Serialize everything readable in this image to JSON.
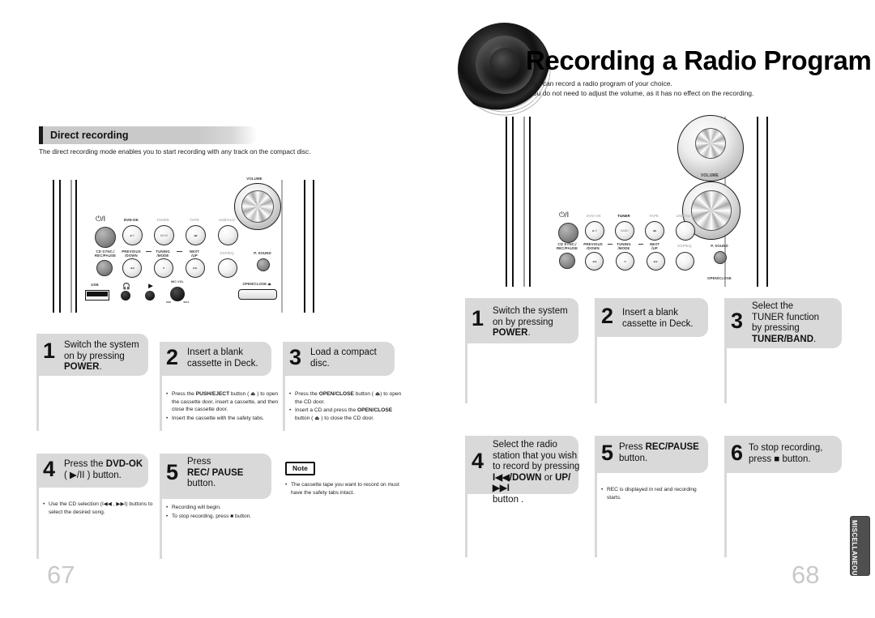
{
  "document": {
    "type": "user-manual-spread",
    "left_page_number": "67",
    "right_page_number": "68",
    "side_tab_label": "MISCELLANEOUS"
  },
  "left_page": {
    "section": {
      "title": "Direct recording",
      "description": "The direct recording mode enables you to start recording with any track on the compact disc."
    },
    "device_panel": {
      "power_glyph": "⏻/I",
      "labels": {
        "volume": "VOLUME",
        "dvd_ok": "DVD-OK",
        "tuner": "TUNER",
        "tape": "TAPE",
        "usb_aux": "USB/AUX",
        "cd_sync": "CD SYNC./",
        "rec_pause": "REC/PAUSE",
        "previous": "PREVIOUS",
        "down": "/DOWN",
        "tuning": "TUNING",
        "mode": "/MODE",
        "next": "NEXT",
        "up": "/UP",
        "dsp_eq": "DSP/EQ",
        "p_sound": "P. SOUND",
        "usb": "USB",
        "mic_vol": "MIC VOL",
        "open_close": "OPEN/CLOSE ⏏",
        "band": "BAND",
        "min": "MIN",
        "max": "MAX"
      }
    },
    "steps": [
      {
        "number": "1",
        "line1": "Switch the system",
        "line2": "on by pressing",
        "line3_bold": "POWER",
        "line3_tail": ".",
        "notes": []
      },
      {
        "number": "2",
        "line1": "Insert a blank",
        "line2": "cassette in Deck.",
        "notes": [
          "Press the PUSH/EJECT button ( ⏏ ) to open the cassette door, insert a cassette, and then close the cassette door.",
          "Insert the cassette with the safety tabs."
        ]
      },
      {
        "number": "3",
        "line1": "Load a compact",
        "line2": "disc.",
        "notes": [
          "Press the OPEN/CLOSE button ( ⏏ ) to open the CD door.",
          "Insert a CD and press the OPEN/CLOSE button ( ⏏ ) to close the CD door."
        ]
      },
      {
        "number": "4",
        "line1": "Press the DVD-OK",
        "line2": "( ▶/II ) button.",
        "notes": [
          "Use the CD selection (I◀◀ , ▶▶I) buttons to select the desired song."
        ]
      },
      {
        "number": "5",
        "line1": "Press",
        "line2": "REC/ PAUSE",
        "line3": "button.",
        "notes": [
          "Recording will begin.",
          "To stop recording, press ■ button."
        ]
      }
    ],
    "note": {
      "tag": "Note",
      "items": [
        "The cassette tape you want to record on must have the safety tabs intact."
      ]
    }
  },
  "right_page": {
    "chapter": {
      "title": "Recording a Radio Program",
      "sub_line1": "You can record a radio program of your choice.",
      "sub_line2": "You do not need to adjust the volume, as it has no effect on the recording."
    },
    "device_panel": {
      "power_glyph": "⏻/I",
      "labels": {
        "volume": "VOLUME",
        "dvd_ok": "DVD-OK",
        "tuner": "TUNER",
        "tape": "TAPE",
        "usb_aux": "USB/AUX",
        "cd_sync": "CD SYNC./",
        "rec_pause": "REC/PAUSE",
        "previous": "PREVIOUS",
        "down": "/DOWN",
        "tuning": "TUNING",
        "mode": "/MODE",
        "next": "NEXT",
        "up": "/UP",
        "dsp_eq": "DSP/EQ",
        "p_sound": "P. SOUND",
        "open_close": "OPEN/CLOSE",
        "band": "BAND"
      }
    },
    "steps": [
      {
        "number": "1",
        "line1": "Switch the system",
        "line2": "on by pressing",
        "line3_bold": "POWER",
        "line3_tail": ".",
        "notes": []
      },
      {
        "number": "2",
        "line1": "Insert a blank",
        "line2": "cassette in Deck.",
        "notes": []
      },
      {
        "number": "3",
        "line1": "Select the",
        "line2": "TUNER function",
        "line3": "by pressing",
        "line4_bold": "TUNER/BAND",
        "line4_tail": ".",
        "notes": []
      },
      {
        "number": "4",
        "line1": "Select the radio",
        "line2": "station that you wish",
        "line3": "to record by pressing",
        "line4_bold": "I◀◀/DOWN",
        "line4_mid": " or ",
        "line4_bold2": "UP/▶▶I",
        "line5": "button .",
        "notes": []
      },
      {
        "number": "5",
        "line1_plain": "Press ",
        "line1_bold": "REC/PAUSE",
        "line2": "button.",
        "notes": [
          "REC is displayed in red and recording starts."
        ]
      },
      {
        "number": "6",
        "line1": "To stop recording,",
        "line2": "press ■ button.",
        "notes": []
      }
    ]
  }
}
